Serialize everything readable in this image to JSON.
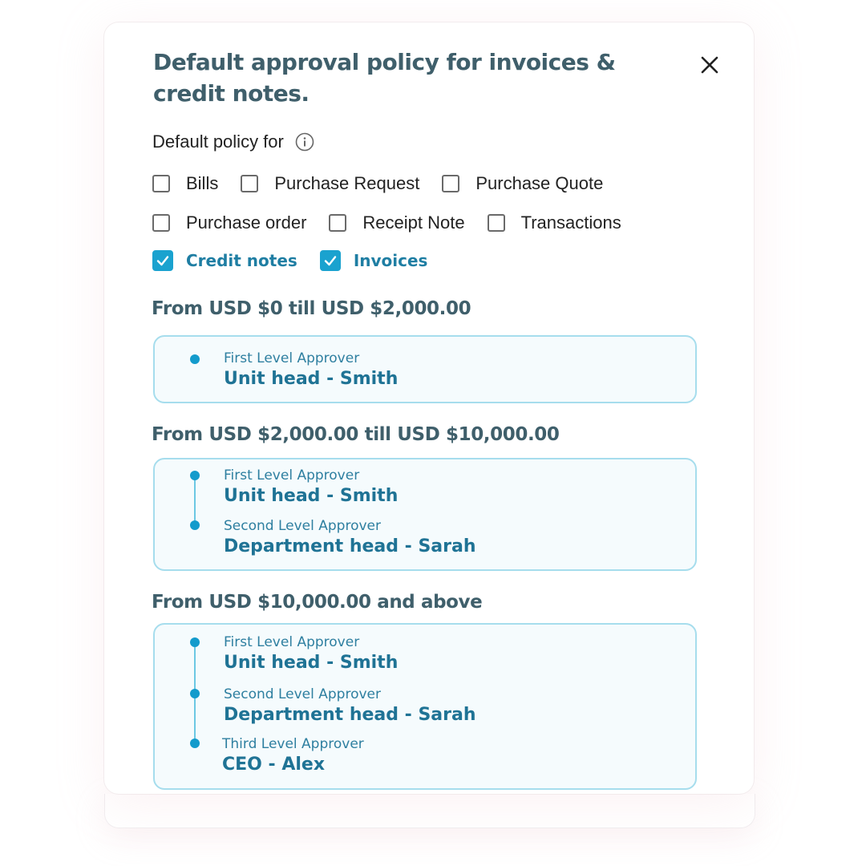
{
  "modal": {
    "title": "Default approval policy for invoices & credit notes.",
    "close_icon": "close-icon",
    "subtitle": "Default policy for",
    "info_icon": "info-icon"
  },
  "document_types": [
    {
      "label": "Bills",
      "checked": false
    },
    {
      "label": "Purchase Request",
      "checked": false
    },
    {
      "label": "Purchase Quote",
      "checked": false
    },
    {
      "label": "Purchase order",
      "checked": false
    },
    {
      "label": "Receipt Note",
      "checked": false
    },
    {
      "label": "Transactions",
      "checked": false
    },
    {
      "label": "Credit notes",
      "checked": true
    },
    {
      "label": "Invoices",
      "checked": true
    }
  ],
  "tiers": [
    {
      "range": "From USD $0 till USD $2,000.00",
      "approvers": [
        {
          "level": "First Level Approver",
          "name": "Unit head - Smith"
        }
      ]
    },
    {
      "range": "From USD $2,000.00 till USD $10,000.00",
      "approvers": [
        {
          "level": "First Level Approver",
          "name": "Unit head - Smith"
        },
        {
          "level": "Second Level Approver",
          "name": "Department head - Sarah"
        }
      ]
    },
    {
      "range": "From USD $10,000.00 and above",
      "approvers": [
        {
          "level": "First Level Approver",
          "name": "Unit head - Smith"
        },
        {
          "level": "Second Level Approver",
          "name": "Department head - Sarah"
        },
        {
          "level": "Third Level Approver",
          "name": "CEO - Alex"
        }
      ]
    }
  ],
  "colors": {
    "title": "#3f5f6b",
    "accent": "#1aa2cf",
    "approver_text": "#1f7395",
    "tier_border": "#a6dded",
    "tier_background": "#f5fbfd"
  }
}
